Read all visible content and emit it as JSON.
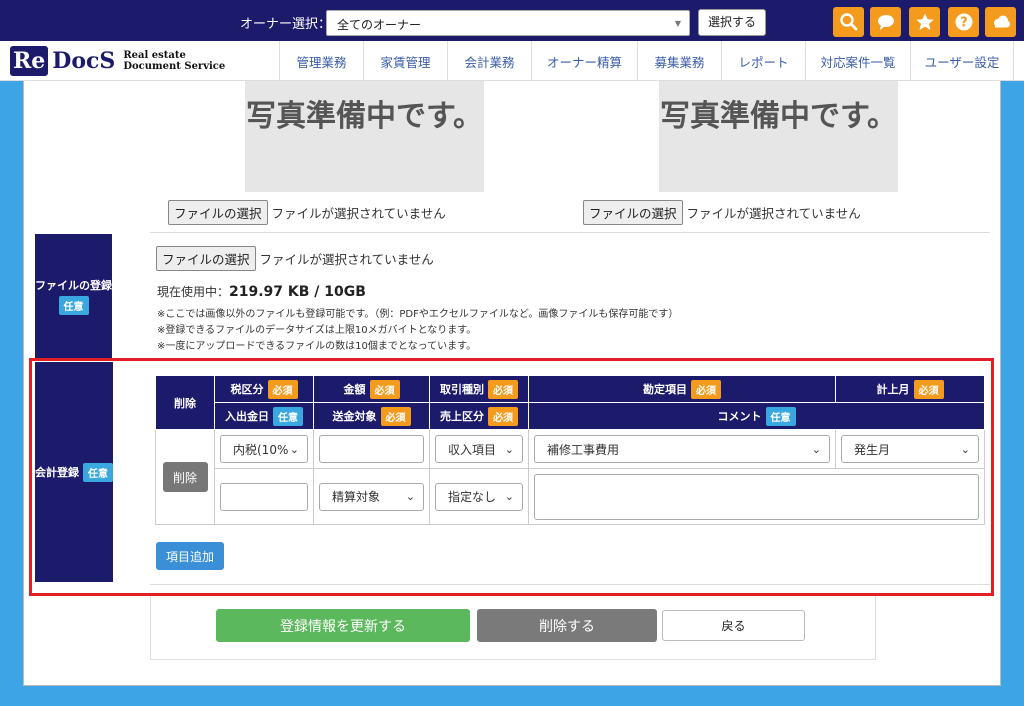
{
  "header": {
    "owner_label": "オーナー選択：",
    "owner_value": "全てのオーナー",
    "select_button": "選択する"
  },
  "logo": {
    "re": "Re",
    "docs": "DocS",
    "sub1": "Real estate",
    "sub2": "Document Service"
  },
  "nav": [
    {
      "label": "管理業務"
    },
    {
      "label": "家賃管理"
    },
    {
      "label": "会計業務"
    },
    {
      "label": "オーナー精算"
    },
    {
      "label": "募集業務"
    },
    {
      "label": "レポート"
    },
    {
      "label": "対応案件一覧"
    },
    {
      "label": "ユーザー設定"
    }
  ],
  "photos": {
    "placeholder_left": "写真準備中です。",
    "placeholder_right": "写真準備中です。",
    "file_button": "ファイルの選択",
    "no_file": "ファイルが選択されていません"
  },
  "file_section": {
    "label": "ファイルの登録",
    "badge": "任意",
    "file_button": "ファイルの選択",
    "no_file": "ファイルが選択されていません",
    "usage_prefix": "現在使用中：",
    "usage_value": "219.97 KB / 10GB",
    "note1": "※ここでは画像以外のファイルも登録可能です。（例：PDFやエクセルファイルなど。画像ファイルも保存可能です）",
    "note2": "※登録できるファイルのデータサイズは上限10メガバイトとなります。",
    "note3": "※一度にアップロードできるファイルの数は10個までとなっています。"
  },
  "accounting": {
    "label": "会計登録",
    "badge": "任意",
    "required": "必須",
    "optional": "任意",
    "headers": {
      "delete": "削除",
      "tax": "税区分",
      "amount": "金額",
      "txn_type": "取引種別",
      "account": "勘定項目",
      "month": "計上月",
      "date": "入出金日",
      "target": "送金対象",
      "sales": "売上区分",
      "comment": "コメント"
    },
    "row": {
      "delete_button": "削除",
      "tax_value": "内税(10%",
      "txn_value": "収入項目",
      "account_value": "補修工事費用",
      "month_value": "発生月",
      "target_value": "精算対象",
      "sales_value": "指定なし"
    },
    "add_button": "項目追加"
  },
  "actions": {
    "update": "登録情報を更新する",
    "delete": "削除する",
    "back": "戻る"
  },
  "colors": {
    "navy": "#1c1a6b",
    "orange": "#f49b1e",
    "blue": "#3aa8e0",
    "green": "#5cb85c",
    "highlight": "#e21f26"
  }
}
